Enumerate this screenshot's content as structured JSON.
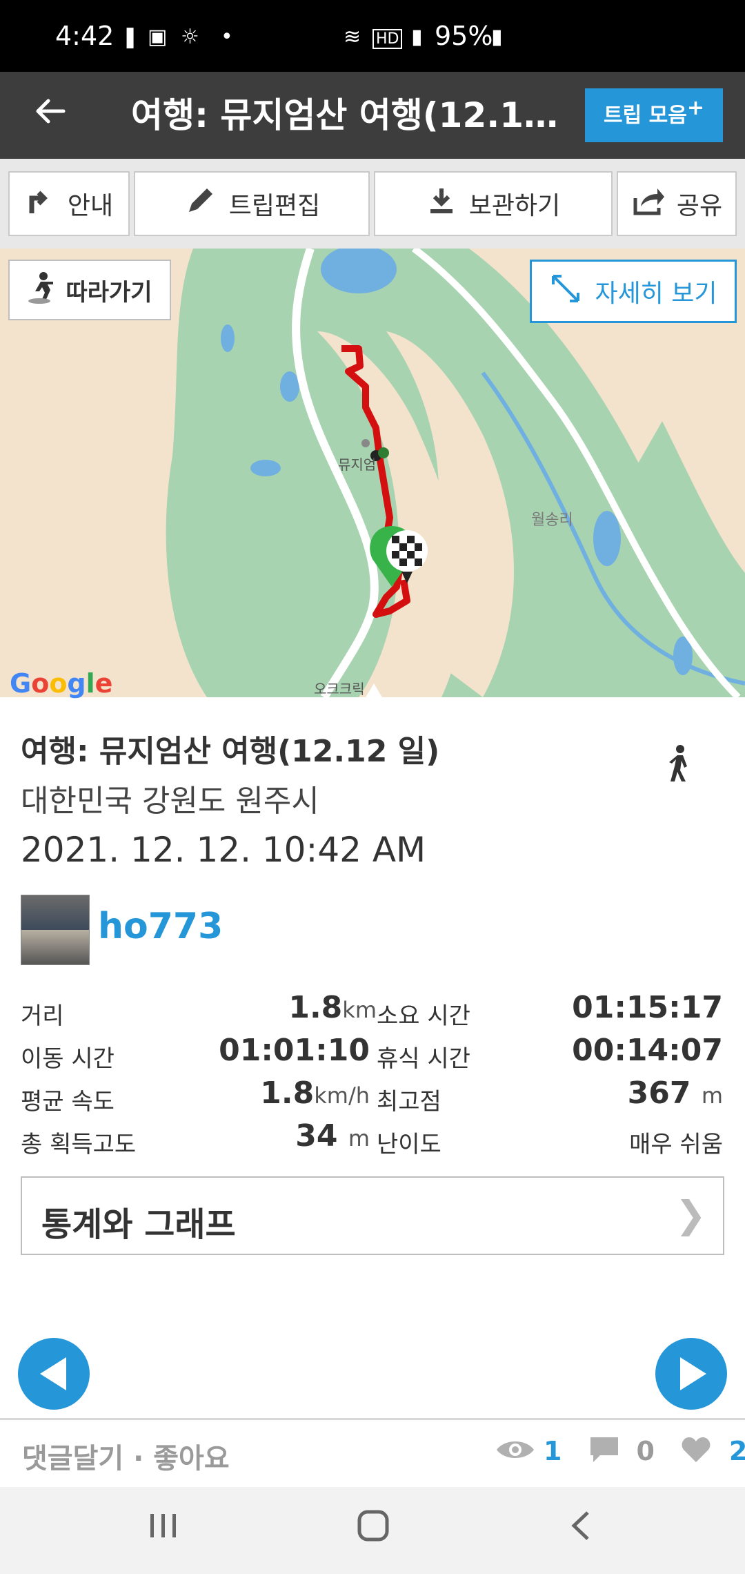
{
  "status_bar": {
    "time": "4:42",
    "battery": "95%"
  },
  "header": {
    "title": "여행: 뮤지엄산 여행(12.12...",
    "trip_collection_button": "트립 모음"
  },
  "toolbar": {
    "guide": "안내",
    "edit": "트립편집",
    "save": "보관하기",
    "share": "공유"
  },
  "map": {
    "follow_button": "따라가기",
    "detail_button": "자세히 보기",
    "place_label_1": "뮤지엄",
    "place_label_2": "월송리",
    "place_label_3": "오크크릭",
    "logo": "Google"
  },
  "trip": {
    "title": "여행: 뮤지엄산 여행(12.12 일)",
    "location": "대한민국 강원도 원주시",
    "datetime": "2021. 12. 12. 10:42 AM",
    "user": "ho773"
  },
  "stats": {
    "distance_label": "거리",
    "distance_value": "1.8",
    "distance_unit": "km",
    "duration_label": "소요 시간",
    "duration_value": "01:15:17",
    "moving_label": "이동 시간",
    "moving_value": "01:01:10",
    "rest_label": "휴식 시간",
    "rest_value": "00:14:07",
    "avg_speed_label": "평균 속도",
    "avg_speed_value": "1.8",
    "avg_speed_unit": "km/h",
    "max_alt_label": "최고점",
    "max_alt_value": "367",
    "max_alt_unit": "m",
    "gain_label": "총 획득고도",
    "gain_value": "34",
    "gain_unit": "m",
    "difficulty_label": "난이도",
    "difficulty_value": "매우 쉬움"
  },
  "stats_graph_button": "통계와 그래프",
  "footer": {
    "comment_like": "댓글달기 · 좋아요",
    "views": "1",
    "comments": "0",
    "likes": "2"
  },
  "colors": {
    "accent": "#2596d8",
    "header_bg": "#3d3d3d",
    "track": "#d40f0f"
  }
}
